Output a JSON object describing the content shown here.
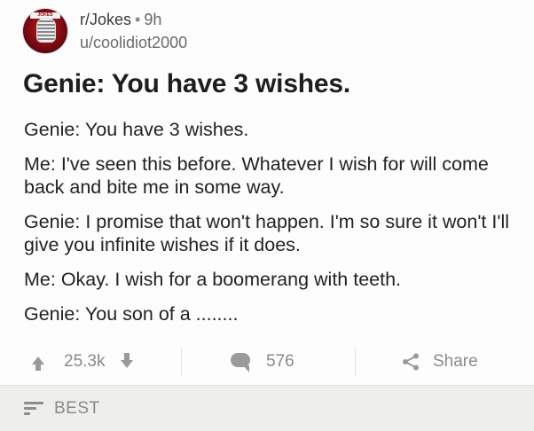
{
  "post": {
    "subreddit": "r/Jokes",
    "separator": "•",
    "age": "9h",
    "author": "u/coolidiot2000",
    "avatar_text": "JOKES",
    "title": "Genie: You have 3 wishes.",
    "body": [
      "Genie: You have 3 wishes.",
      "Me: I've seen this before. Whatever I wish for will come back and bite me in some way.",
      "Genie: I promise that won't happen. I'm so sure it won't I'll give you infinite wishes if it does.",
      "Me: Okay. I wish for a boomerang with teeth.",
      "Genie: You son of a ........"
    ]
  },
  "actions": {
    "score": "25.3k",
    "comments": "576",
    "share_label": "Share",
    "upvote_icon": "arrow-up-icon",
    "downvote_icon": "arrow-down-icon",
    "comment_icon": "comment-bubble-icon",
    "share_icon": "share-icon"
  },
  "sort": {
    "label": "BEST",
    "icon": "sort-icon"
  },
  "colors": {
    "text": "#222222",
    "muted": "#8a8a8a",
    "sortbar_bg": "#eeeeec"
  }
}
